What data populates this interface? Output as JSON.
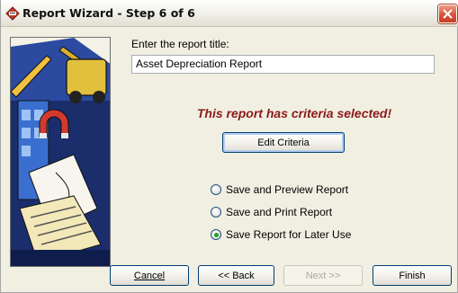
{
  "window": {
    "title": "Report Wizard - Step 6 of 6"
  },
  "form": {
    "title_prompt": "Enter the report title:",
    "title_value": "Asset Depreciation Report",
    "criteria_notice": "This report has criteria selected!",
    "edit_criteria_label": "Edit Criteria"
  },
  "options": [
    {
      "label": "Save and Preview Report",
      "checked": false
    },
    {
      "label": "Save and Print Report",
      "checked": false
    },
    {
      "label": "Save Report for Later Use",
      "checked": true
    }
  ],
  "footer": {
    "cancel_label": "Cancel",
    "back_label": "<< Back",
    "next_label": "Next >>",
    "finish_label": "Finish"
  },
  "colors": {
    "notice": "#8b1a1a",
    "close_button": "#d9523a"
  }
}
